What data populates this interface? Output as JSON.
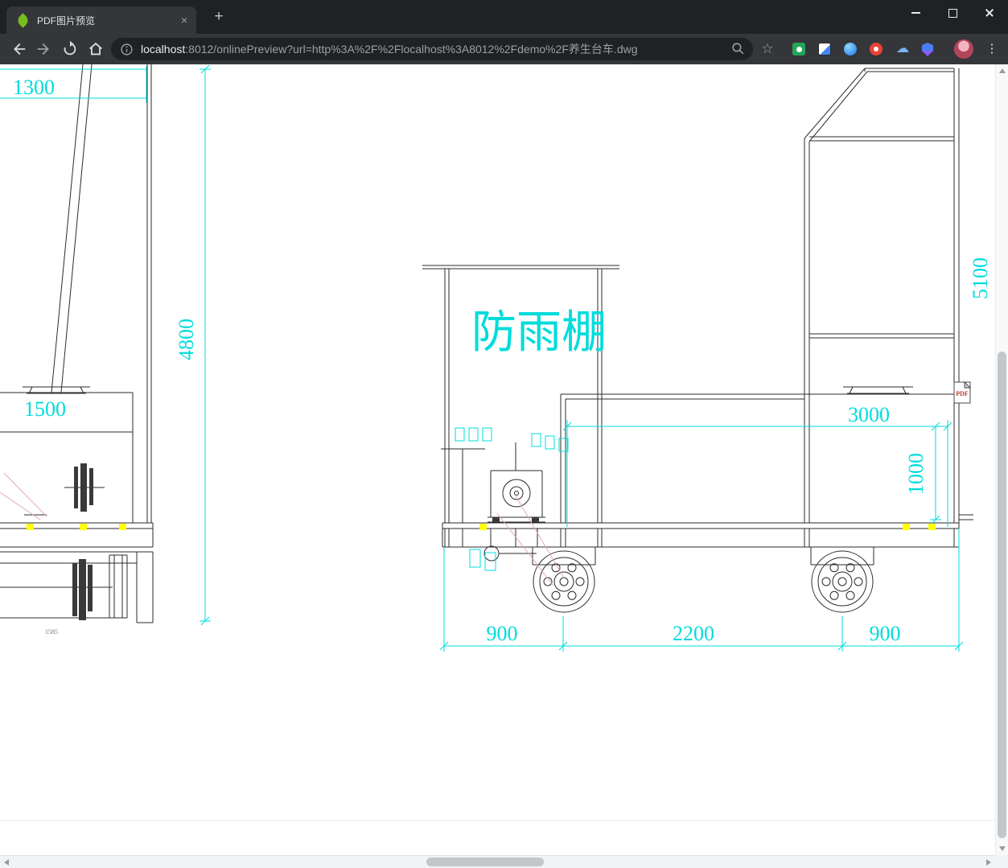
{
  "browser": {
    "tab_title": "PDF图片预览",
    "url_host": "localhost",
    "url_rest": ":8012/onlinePreview?url=http%3A%2F%2Flocalhost%3A8012%2Fdemo%2F养生台车.dwg",
    "icons": {
      "tab_close": "×",
      "new_tab": "+",
      "menu_dots": "⋮",
      "star": "☆",
      "cloud": "☁"
    }
  },
  "drawing": {
    "labels": {
      "dim_top_left": "1300",
      "dim_height_left": "4800",
      "dim_pedestal": "1500",
      "shelter": "防雨棚",
      "dim_height_right": "5100",
      "dim_bed_length": "3000",
      "dim_bed_height": "1000",
      "dim_wheel_left": "900",
      "dim_wheelbase": "2200",
      "dim_wheel_right": "900",
      "dim_small": "1585",
      "pdf_badge": "PDF"
    },
    "colors": {
      "dimension_cyan": "#00dcdc",
      "highlight_yellow": "#ffff00",
      "chrome_dark": "#202124",
      "toolbar_gray": "#35363a"
    }
  }
}
